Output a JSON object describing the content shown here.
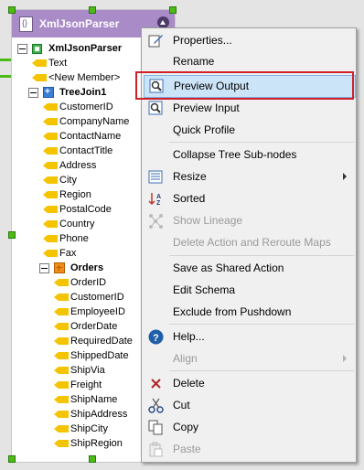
{
  "node": {
    "title": "XmlJsonParser",
    "tree": {
      "root": "XmlJsonParser",
      "text": "Text",
      "new_member": "<New Member>",
      "treejoin": "TreeJoin1",
      "treejoin_fields": [
        "CustomerID",
        "CompanyName",
        "ContactName",
        "ContactTitle",
        "Address",
        "City",
        "Region",
        "PostalCode",
        "Country",
        "Phone",
        "Fax"
      ],
      "orders": "Orders",
      "orders_fields": [
        "OrderID",
        "CustomerID",
        "EmployeeID",
        "OrderDate",
        "RequiredDate",
        "ShippedDate",
        "ShipVia",
        "Freight",
        "ShipName",
        "ShipAddress",
        "ShipCity",
        "ShipRegion"
      ]
    }
  },
  "menu": {
    "properties": "Properties...",
    "rename": "Rename",
    "preview_output": "Preview Output",
    "preview_input": "Preview Input",
    "quick_profile": "Quick Profile",
    "collapse_tree": "Collapse Tree Sub-nodes",
    "resize": "Resize",
    "sorted": "Sorted",
    "show_lineage": "Show Lineage",
    "delete_action": "Delete Action and Reroute Maps",
    "save_shared": "Save as Shared Action",
    "edit_schema": "Edit Schema",
    "exclude_pushdown": "Exclude from Pushdown",
    "help": "Help...",
    "align": "Align",
    "delete": "Delete",
    "cut": "Cut",
    "copy": "Copy",
    "paste": "Paste"
  },
  "colors": {
    "header": "#a98bc7",
    "highlight": "#cce4f7",
    "redbox": "#d0202a",
    "connector": "#4cbb17"
  }
}
